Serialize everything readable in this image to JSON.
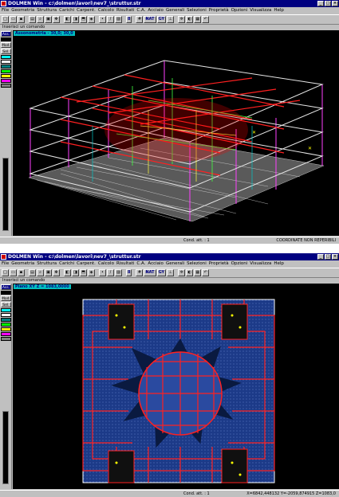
{
  "window1": {
    "title": "DOLMEN Win - c:\\dolmen\\lavori\\nev7_\\struttur.str",
    "menu": [
      "File",
      "Geometria",
      "Struttura",
      "Carichi",
      "Carpent.",
      "Calcolo",
      "Risultati",
      "C.A.",
      "Acciaio",
      "Generali",
      "Selezioni",
      "Proprietà",
      "Opzioni",
      "Visualizza",
      "Help"
    ],
    "toolbar_text": {
      "num": "8",
      "nav": "N̶AT",
      "gy": "GY"
    },
    "command": "Inserisci un comando",
    "view_label": "Assonometria - 30,0; 30,0",
    "left_panel": [
      "Ass.",
      "Mod.",
      "Sel."
    ],
    "status_cond": "Cond. att. : 1",
    "status_coord": "COORDINATE NON REPERIBILI"
  },
  "window2": {
    "title": "DOLMEN Win - c:\\dolmen\\lavori\\nev7_\\struttur.str",
    "menu": [
      "File",
      "Geometria",
      "Struttura",
      "Carichi",
      "Carpent.",
      "Calcolo",
      "Risultati",
      "C.A.",
      "Acciaio",
      "Generali",
      "Selezioni",
      "Proprietà",
      "Opzioni",
      "Visualizza",
      "Help"
    ],
    "toolbar_text": {
      "num": "8",
      "nav": "N̶AT",
      "gy": "GY"
    },
    "command": "Inserisci un comando",
    "view_label": "Piano XY Z = 1083,0000",
    "left_panel": [
      "Ass.",
      "Mod.",
      "Sel."
    ],
    "status_cond": "Cond. att. : 1",
    "status_coord": "X=6842,448132 Y=-2059,874915 Z=1083,0"
  },
  "swatch_colors": [
    "#00ffff",
    "#ffffff",
    "#008080",
    "#00ff00",
    "#ffff00",
    "#ff00ff",
    "#808080",
    "#c0c0c0"
  ]
}
